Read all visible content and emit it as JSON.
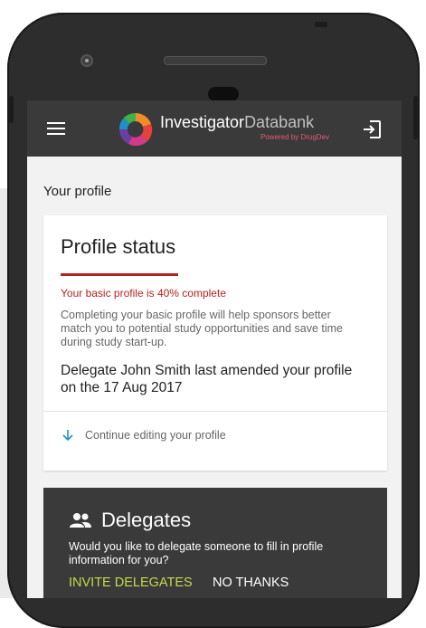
{
  "header": {
    "brand_primary": "Investigator",
    "brand_secondary": "Databank",
    "brand_tagline": "Powered by DrugDev",
    "menu_icon": "hamburger-menu-icon",
    "logout_icon": "logout-icon"
  },
  "page": {
    "title": "Your profile"
  },
  "profile_status": {
    "title": "Profile status",
    "progress_percent": 40,
    "progress_text": "Your basic profile is 40% complete",
    "description": "Completing your basic profile will help sponsors better match you to potential study opportunities and save time during  study start-up.",
    "amended_text": "Delegate John Smith last amended your profile on the 17 Aug 2017",
    "continue_label": "Continue editing your profile",
    "continue_icon": "arrow-down-icon"
  },
  "delegates": {
    "title": "Delegates",
    "icon": "people-icon",
    "description": "Would you like to delegate someone to fill in profile information for you?",
    "invite_label": "INVITE DELEGATES",
    "no_thanks_label": "NO THANKS"
  },
  "colors": {
    "app_bar": "#3a3a3a",
    "accent_red": "#b22222",
    "accent_green": "#c6d94a",
    "continue_arrow": "#1f8fc9"
  }
}
